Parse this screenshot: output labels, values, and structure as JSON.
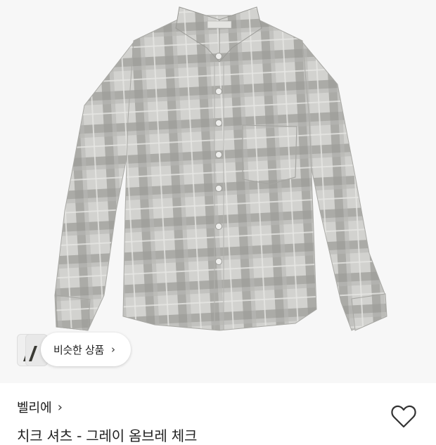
{
  "product": {
    "image_alt": "gray ombre check shirt",
    "brand": "벨리에",
    "title": "치크 셔츠 - 그레이 옴브레 체크"
  },
  "similar_products": {
    "label": "비슷한 상품",
    "chevron": "›"
  },
  "brand_chevron": "›",
  "icons": {
    "wishlist": "heart-outline-icon",
    "chevron": "chevron-right-icon"
  },
  "colors": {
    "shirt": "#c9c9c6",
    "check_dark": "#8c8c88",
    "background": "#f7f7f7"
  }
}
